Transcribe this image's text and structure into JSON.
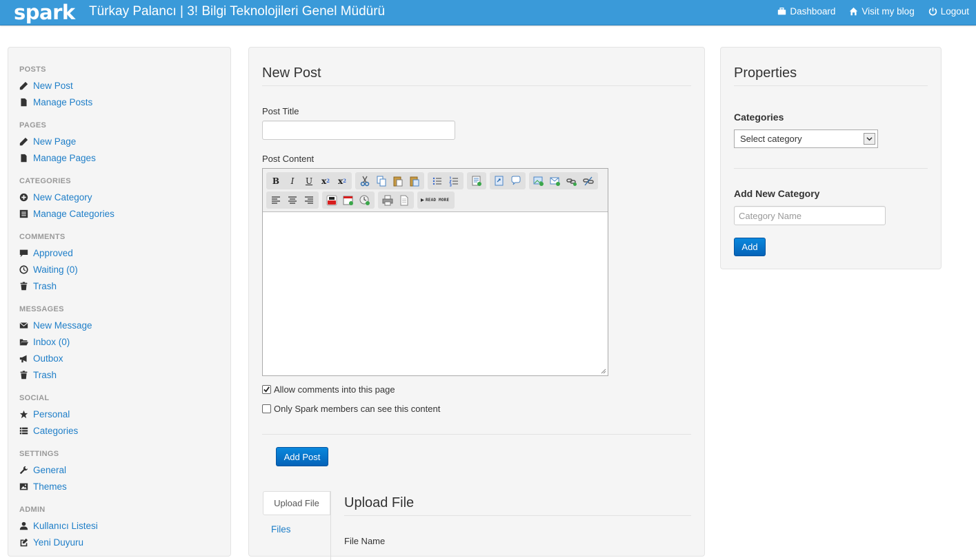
{
  "topbar": {
    "brand": "spark",
    "title": "Türkay Palancı | 3! Bilgi Teknolojileri Genel Müdürü",
    "links": [
      {
        "label": "Dashboard",
        "icon": "briefcase-icon"
      },
      {
        "label": "Visit my blog",
        "icon": "home-icon"
      },
      {
        "label": "Logout",
        "icon": "power-icon"
      }
    ]
  },
  "sidebar": {
    "sections": [
      {
        "header": "POSTS",
        "items": [
          {
            "label": "New Post",
            "icon": "pencil-icon"
          },
          {
            "label": "Manage Posts",
            "icon": "file-icon"
          }
        ]
      },
      {
        "header": "PAGES",
        "items": [
          {
            "label": "New Page",
            "icon": "pencil-icon"
          },
          {
            "label": "Manage Pages",
            "icon": "file-icon"
          }
        ]
      },
      {
        "header": "CATEGORIES",
        "items": [
          {
            "label": "New Category",
            "icon": "plus-circle-icon"
          },
          {
            "label": "Manage Categories",
            "icon": "list-alt-icon"
          }
        ]
      },
      {
        "header": "COMMENTS",
        "items": [
          {
            "label": "Approved",
            "icon": "comment-icon"
          },
          {
            "label": "Waiting (0)",
            "icon": "clock-icon"
          },
          {
            "label": "Trash",
            "icon": "trash-icon"
          }
        ]
      },
      {
        "header": "MESSAGES",
        "items": [
          {
            "label": "New Message",
            "icon": "envelope-icon"
          },
          {
            "label": "Inbox (0)",
            "icon": "folder-open-icon"
          },
          {
            "label": "Outbox",
            "icon": "bullhorn-icon"
          },
          {
            "label": "Trash",
            "icon": "trash-icon"
          }
        ]
      },
      {
        "header": "SOCIAL",
        "items": [
          {
            "label": "Personal",
            "icon": "star-icon"
          },
          {
            "label": "Categories",
            "icon": "th-list-icon"
          }
        ]
      },
      {
        "header": "SETTINGS",
        "items": [
          {
            "label": "General",
            "icon": "wrench-icon"
          },
          {
            "label": "Themes",
            "icon": "picture-icon"
          }
        ]
      },
      {
        "header": "ADMIN",
        "items": [
          {
            "label": "Kullanıcı Listesi",
            "icon": "user-icon"
          },
          {
            "label": "Yeni Duyuru",
            "icon": "edit-icon"
          }
        ]
      }
    ]
  },
  "main": {
    "title": "New Post",
    "post_title_label": "Post Title",
    "post_title_value": "",
    "post_content_label": "Post Content",
    "toolbar": {
      "read_more": "READ MORE"
    },
    "allow_comments_label": "Allow comments into this page",
    "allow_comments_checked": true,
    "members_only_label": "Only Spark members can see this content",
    "members_only_checked": false,
    "add_post_label": "Add Post",
    "upload_tab_label": "Upload File",
    "files_tab_label": "Files",
    "upload_title": "Upload File",
    "file_name_label": "File Name"
  },
  "properties": {
    "title": "Properties",
    "categories_label": "Categories",
    "category_select_value": "Select category",
    "add_new_category_label": "Add New Category",
    "category_name_placeholder": "Category Name",
    "add_label": "Add"
  },
  "colors": {
    "topbar": "#3a9ad9",
    "link": "#1e7ec8",
    "primary_button": "#0563b8"
  }
}
